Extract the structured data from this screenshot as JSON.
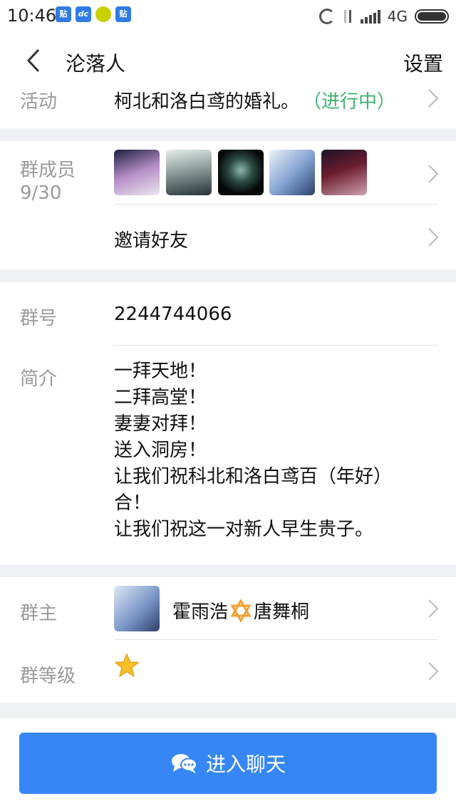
{
  "status_bar": {
    "time": "10:46",
    "network": "4G",
    "apps": [
      {
        "icon": "tieba-icon",
        "text": "贴",
        "color": "#2f7be6"
      },
      {
        "icon": "store-icon",
        "text": "dc",
        "color": "#2f7be6"
      },
      {
        "icon": "qq-browser-icon",
        "text": "",
        "color": "#c9d000"
      },
      {
        "icon": "tieba-icon",
        "text": "贴",
        "color": "#2f7be6"
      }
    ]
  },
  "nav": {
    "title": "沦落人",
    "settings_label": "设置"
  },
  "activity": {
    "label": "活动",
    "value": "柯北和洛白鸢的婚礼。",
    "status": "（进行中）"
  },
  "members": {
    "label": "群成员",
    "count": "9/30",
    "invite_label": "邀请好友"
  },
  "group_info": {
    "id_label": "群号",
    "id_value": "2244744066",
    "intro_label": "简介",
    "intro_text": "一拜天地！\n二拜高堂！\n妻妻对拜！\n送入洞房！\n让我们祝科北和洛白鸢百（年好）\n合！\n让我们祝这一对新人早生贵子。"
  },
  "owner": {
    "label": "群主",
    "name_part1": "霍雨浩",
    "name_part2": "唐舞桐",
    "level_label": "群等级"
  },
  "chat_button": {
    "label": "进入聊天"
  },
  "colors": {
    "accent": "#3687f5",
    "status_green": "#3db46d",
    "label_gray": "#9a9a9a",
    "background": "#f0f1f4"
  }
}
